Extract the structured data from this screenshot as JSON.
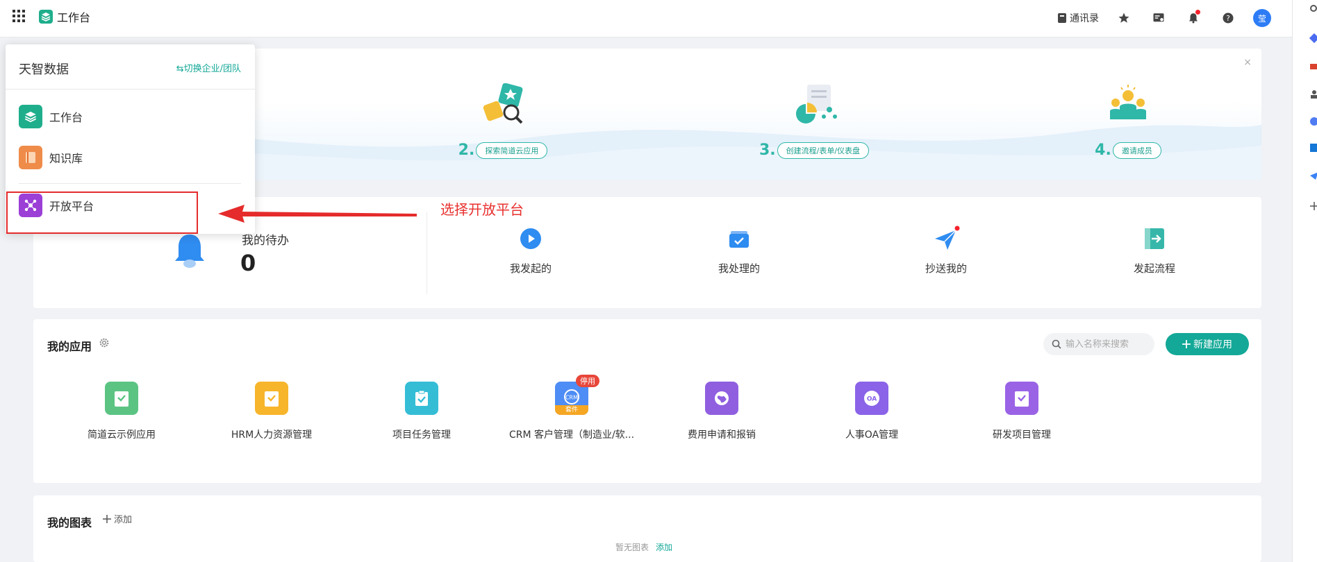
{
  "topbar": {
    "brand_title": "工作台",
    "contacts_label": "通讯录",
    "avatar_text": "莹"
  },
  "banner": {
    "close_glyph": "×",
    "steps": [
      {
        "num": "2.",
        "label": "探索简道云应用",
        "icon": "explore-apps-illustration"
      },
      {
        "num": "3.",
        "label": "创建流程/表单/仪表盘",
        "icon": "create-flow-illustration"
      },
      {
        "num": "4.",
        "label": "邀请成员",
        "icon": "invite-members-illustration"
      }
    ]
  },
  "todo": {
    "label": "我的待办",
    "count": "0",
    "items": [
      {
        "label": "我发起的",
        "icon": "play-circle-icon"
      },
      {
        "label": "我处理的",
        "icon": "inbox-check-icon"
      },
      {
        "label": "抄送我的",
        "icon": "paper-plane-icon"
      },
      {
        "label": "发起流程",
        "icon": "start-flow-icon"
      }
    ]
  },
  "annotation": {
    "text": "选择开放平台",
    "color": "#e8302e"
  },
  "apps": {
    "title": "我的应用",
    "search_placeholder": "输入名称来搜索",
    "new_app_label": "新建应用",
    "items": [
      {
        "name": "简道云示例应用",
        "color": "#5cc483"
      },
      {
        "name": "HRM人力资源管理",
        "color": "#f7b52c"
      },
      {
        "name": "项目任务管理",
        "color": "#35bdd6"
      },
      {
        "name": "CRM 客户管理（制造业/软...",
        "color": "#4e8df5",
        "badge": "停用",
        "icon_text": "CRM",
        "suite": "套件"
      },
      {
        "name": "费用申请和报销",
        "color": "#8f5fe0"
      },
      {
        "name": "人事OA管理",
        "color": "#8a63e8",
        "icon_text": "OA"
      },
      {
        "name": "研发项目管理",
        "color": "#9a63e6"
      }
    ]
  },
  "charts": {
    "title": "我的图表",
    "add_label": "添加",
    "empty_text": "暂无图表",
    "empty_add": "添加"
  },
  "dropdown": {
    "org_name": "天智数据",
    "switch_label": "⇆切换企业/团队",
    "items": [
      {
        "label": "工作台",
        "color": "#1fae8c"
      },
      {
        "label": "知识库",
        "color": "#ef8c4a"
      },
      {
        "label": "开放平台",
        "color": "#9b3fd6"
      }
    ]
  },
  "colors": {
    "accent": "#13a897",
    "highlight": "#e52b2b"
  }
}
